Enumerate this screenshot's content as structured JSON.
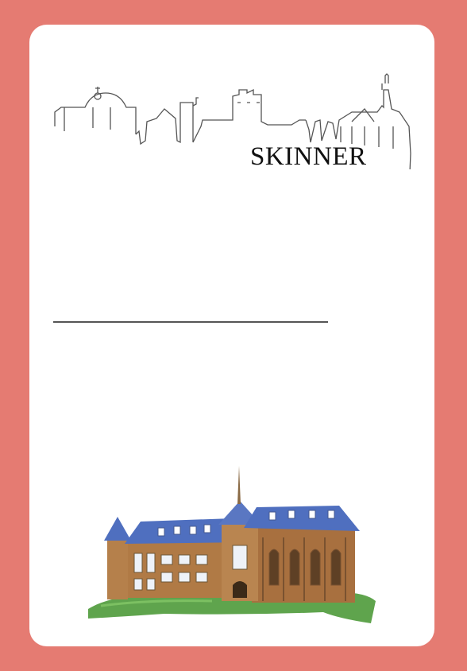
{
  "card": {
    "house_name": "SKINNER"
  },
  "colors": {
    "border": "#e57b72",
    "card": "#ffffff",
    "roof": "#4f6fbf",
    "brick": "#b07a45",
    "grass": "#4e9a3a"
  },
  "icons": {
    "skyline": "city-skyline-outline",
    "building": "school-building-illustration"
  }
}
